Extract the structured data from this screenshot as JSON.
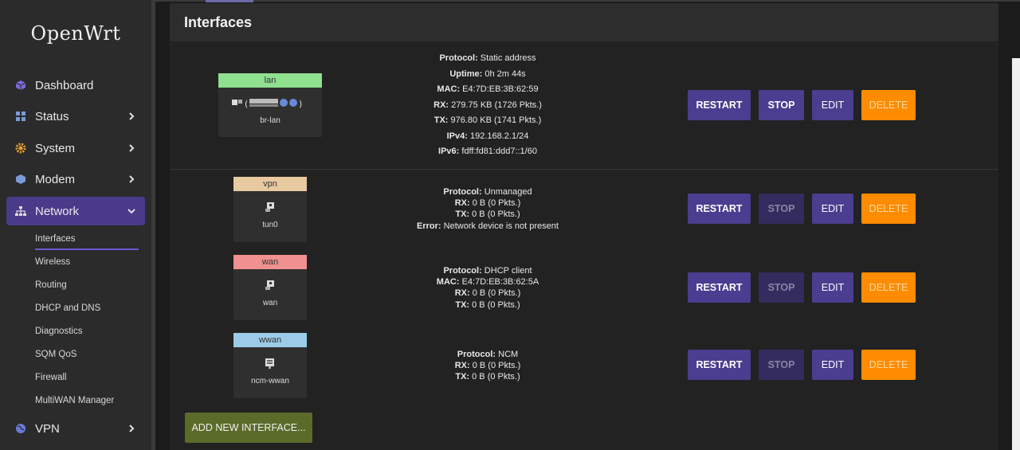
{
  "brand": "OpenWrt",
  "nav": {
    "items": [
      {
        "label": "Dashboard",
        "icon": "cube-icon"
      },
      {
        "label": "Status",
        "icon": "grid-icon"
      },
      {
        "label": "System",
        "icon": "gear-icon"
      },
      {
        "label": "Modem",
        "icon": "cube-icon"
      },
      {
        "label": "Network",
        "icon": "network-icon"
      },
      {
        "label": "VPN",
        "icon": "globe-icon"
      }
    ],
    "network_sub": [
      "Interfaces",
      "Wireless",
      "Routing",
      "DHCP and DNS",
      "Diagnostics",
      "SQM QoS",
      "Firewall",
      "MultiWAN Manager"
    ]
  },
  "panel": {
    "title": "Interfaces"
  },
  "interfaces": [
    {
      "name": "lan",
      "device": "br-lan",
      "color": "#8fe08f",
      "info": [
        {
          "k": "Protocol:",
          "v": " Static address"
        },
        {
          "k": "Uptime:",
          "v": " 0h 2m 44s"
        },
        {
          "k": "MAC:",
          "v": " E4:7D:EB:3B:62:59"
        },
        {
          "k": "RX:",
          "v": " 279.75 KB (1726 Pkts.)"
        },
        {
          "k": "TX:",
          "v": " 976.80 KB (1741 Pkts.)"
        },
        {
          "k": "IPv4:",
          "v": " 192.168.2.1/24"
        },
        {
          "k": "IPv6:",
          "v": " fdff:fd81:ddd7::1/60"
        }
      ],
      "stop_enabled": true
    },
    {
      "name": "vpn",
      "device": "tun0",
      "color": "#e8c9a0",
      "info": [
        {
          "k": "Protocol:",
          "v": " Unmanaged"
        },
        {
          "k": "RX:",
          "v": " 0 B (0 Pkts.)"
        },
        {
          "k": "TX:",
          "v": " 0 B (0 Pkts.)"
        },
        {
          "k": "Error:",
          "v": " Network device is not present"
        }
      ],
      "stop_enabled": false
    },
    {
      "name": "wan",
      "device": "wan",
      "color": "#f09090",
      "info": [
        {
          "k": "Protocol:",
          "v": " DHCP client"
        },
        {
          "k": "MAC:",
          "v": " E4:7D:EB:3B:62:5A"
        },
        {
          "k": "RX:",
          "v": " 0 B (0 Pkts.)"
        },
        {
          "k": "TX:",
          "v": " 0 B (0 Pkts.)"
        }
      ],
      "stop_enabled": false
    },
    {
      "name": "wwan",
      "device": "ncm-wwan",
      "color": "#9ccbe8",
      "info": [
        {
          "k": "Protocol:",
          "v": " NCM"
        },
        {
          "k": "RX:",
          "v": " 0 B (0 Pkts.)"
        },
        {
          "k": "TX:",
          "v": " 0 B (0 Pkts.)"
        }
      ],
      "stop_enabled": false
    }
  ],
  "buttons": {
    "restart": "RESTART",
    "stop": "STOP",
    "edit": "EDIT",
    "delete": "DELETE",
    "add": "ADD NEW INTERFACE..."
  }
}
